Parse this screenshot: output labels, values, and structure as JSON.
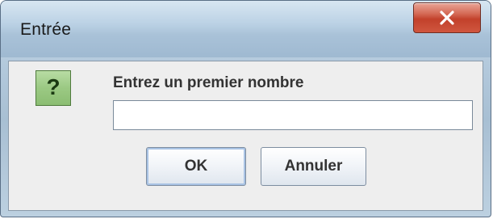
{
  "window": {
    "title": "Entrée",
    "close_icon": "close-icon",
    "accent_close": "#c2412b"
  },
  "dialog": {
    "icon": "question-icon",
    "icon_glyph": "?",
    "icon_color": "#9bc983",
    "prompt": "Entrez un premier nombre",
    "input_value": "",
    "ok_label": "OK",
    "cancel_label": "Annuler"
  }
}
